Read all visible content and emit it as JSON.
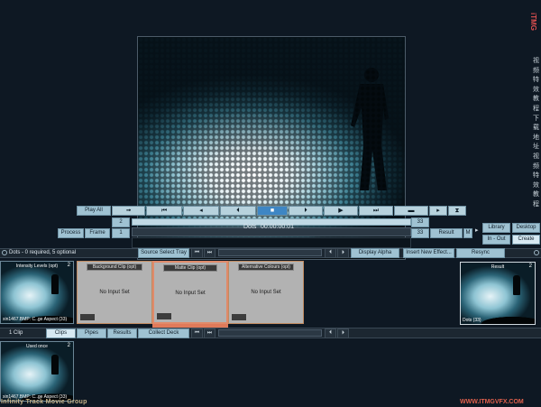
{
  "app": {
    "title": "Infinity Track Movie Group",
    "watermark": "WWW.ITMGVFX.COM",
    "brand": "iTMG"
  },
  "side_chars": [
    "视",
    "频",
    "特",
    "效",
    "教",
    "程",
    "下",
    "载",
    "地",
    "址",
    "视",
    "频",
    "特",
    "效",
    "教",
    "程",
    "下",
    "载",
    "地",
    "址"
  ],
  "transport": {
    "play_all": "Play All",
    "buttons": [
      "arrow",
      "skip-start",
      "step-back",
      "prev-key",
      "stop",
      "next-key",
      "play",
      "skip-end",
      "range",
      "step-fwd",
      "end"
    ]
  },
  "timeline": {
    "row1_left_num": "2",
    "row1_right_num": "33",
    "row2_left_num": "1",
    "row2_right_num": "33",
    "process": "Process",
    "frame": "Frame",
    "effect_name": "Dots",
    "timecode": "00:00:00:01",
    "result": "Result",
    "mode": "M"
  },
  "right_panel": {
    "library": "Library",
    "desktop": "Desktop",
    "in_out": "In - Out",
    "create": "Create"
  },
  "effect_bar": {
    "status": "Dots - 0 required, 5 optional",
    "source_select_tray": "Source Select Tray",
    "display_alpha": "Display Alpha",
    "insert_effect": "Insert New Effect...",
    "resync": "Resync"
  },
  "inputs": [
    {
      "title": "Intensity Levels (opt)",
      "num": "2",
      "caption": "xin1467.BMP: C..ge Aspect (33)"
    },
    {
      "title": "Background Clip (opt)",
      "message": "No Input Set"
    },
    {
      "title": "Matte Clip (opt)",
      "message": "No Input Set"
    },
    {
      "title": "Alternative Colours (opt)",
      "message": "No Input Set"
    }
  ],
  "result": {
    "title": "Result",
    "num": "2",
    "caption": "Dots (33)"
  },
  "bin_bar": {
    "count": "1 Clip",
    "tabs": [
      "Clips",
      "Pipes",
      "Results",
      "Collect Deck"
    ]
  },
  "bin_clip": {
    "title": "Used once",
    "num": "2",
    "caption": "xin1467.BMP: C..ge Aspect (33)"
  }
}
